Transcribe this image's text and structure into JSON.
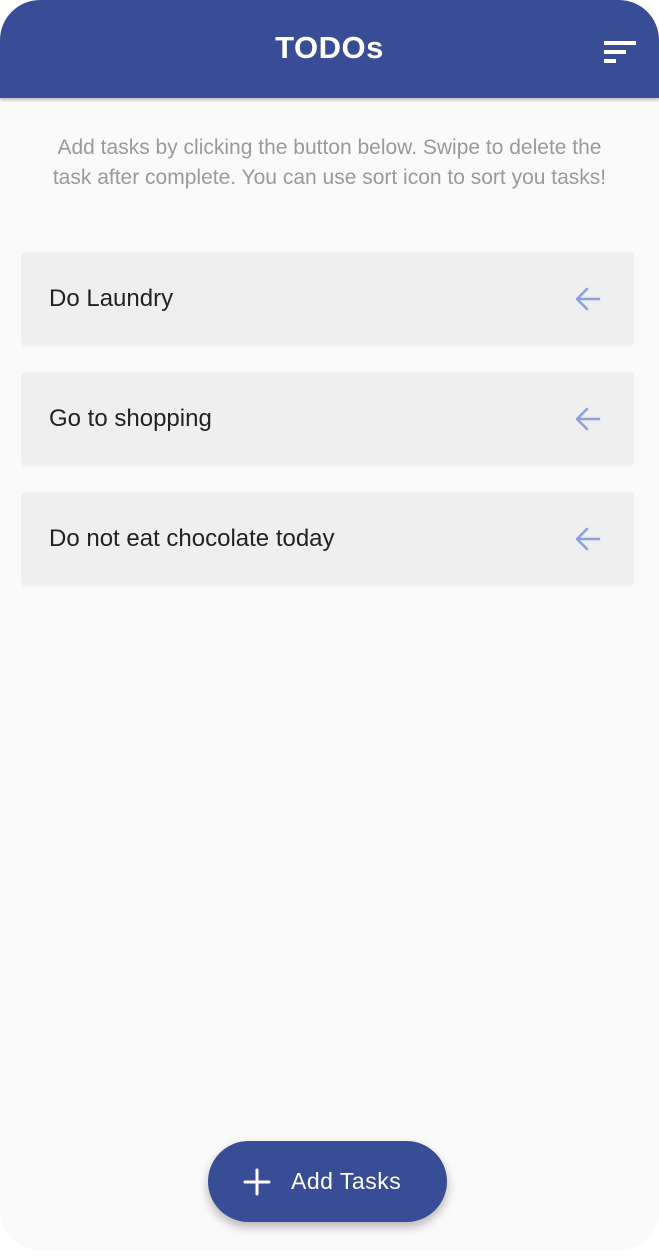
{
  "app": {
    "title": "TODOs",
    "sort_icon": "sort-icon",
    "brand_color": "#394d97"
  },
  "hint": {
    "text": "Add tasks by clicking the button below. Swipe to delete the task after complete. You can use sort icon to sort you tasks!"
  },
  "tasks": [
    {
      "label": "Do Laundry",
      "icon": "arrow-left-icon"
    },
    {
      "label": "Go to shopping",
      "icon": "arrow-left-icon"
    },
    {
      "label": "Do not eat chocolate today",
      "icon": "arrow-left-icon"
    }
  ],
  "fab": {
    "label": "Add Tasks",
    "icon": "plus-icon"
  }
}
